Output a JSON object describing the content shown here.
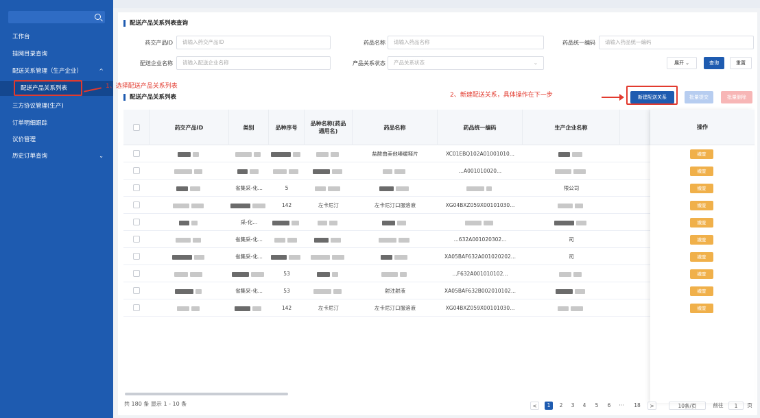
{
  "sidebar": {
    "items": [
      {
        "label": "工作台"
      },
      {
        "label": "挂网目录查询"
      },
      {
        "label": "配送关系管理（生产企业）",
        "chevron": "^"
      },
      {
        "label": "配送产品关系列表"
      },
      {
        "label": "三方协议管理(生产)"
      },
      {
        "label": "订单明细跟踪"
      },
      {
        "label": "议价管理"
      },
      {
        "label": "历史订单查询",
        "chevron": "⌄"
      }
    ]
  },
  "query": {
    "title": "配送产品关系列表查询",
    "fields": [
      {
        "label": "药交产品ID",
        "placeholder": "请输入药交产品ID"
      },
      {
        "label": "药品名称",
        "placeholder": "请输入药品名称"
      },
      {
        "label": "药品统一编码",
        "placeholder": "请输入药品统一编码"
      },
      {
        "label": "配送企业名称",
        "placeholder": "请输入配送企业名称"
      },
      {
        "label": "产品关系状态",
        "placeholder": "产品关系状态"
      }
    ],
    "expand_label": "展开 ⌄",
    "search_label": "查询",
    "reset_label": "重置"
  },
  "list": {
    "title": "配送产品关系列表",
    "new_label": "新建配送关系",
    "batch_submit_label": "批量提交",
    "batch_delete_label": "批量删除"
  },
  "annotations": {
    "step1": "1、选择配送产品关系列表",
    "step2": "2、新建配送关系，具体操作在下一步"
  },
  "table": {
    "headers": [
      "药交产品ID",
      "类别",
      "品种序号",
      "品种名称(药品通用名)",
      "药品名称",
      "药品统一编码",
      "生产企业名称",
      "",
      "操作"
    ],
    "row_action": "撤废",
    "rows": [
      {
        "cat": "",
        "seq": "",
        "name": "",
        "drug": "盐酸曲美他嗪缓释片",
        "code": "XC01EBQ102A01001010...",
        "mfr": ""
      },
      {
        "cat": "",
        "seq": "",
        "name": "",
        "drug": "",
        "code": "...A001010020...",
        "mfr": ""
      },
      {
        "cat": "省集采-化...",
        "seq": "5",
        "name": "",
        "drug": "",
        "code": "",
        "mfr": "限公司"
      },
      {
        "cat": "",
        "seq": "142",
        "name": "左卡尼汀",
        "drug": "左卡尼汀口服溶液",
        "code": "XG04BXZ059X00101030...",
        "mfr": ""
      },
      {
        "cat": "采-化...",
        "seq": "",
        "name": "",
        "drug": "",
        "code": "",
        "mfr": ""
      },
      {
        "cat": "省集采-化...",
        "seq": "",
        "name": "",
        "drug": "",
        "code": "...632A001020302...",
        "mfr": "司"
      },
      {
        "cat": "省集采-化...",
        "seq": "",
        "name": "",
        "drug": "",
        "code": "XA05BAF632A001020202...",
        "mfr": "司"
      },
      {
        "cat": "",
        "seq": "53",
        "name": "",
        "drug": "",
        "code": "...F632A001010102...",
        "mfr": ""
      },
      {
        "cat": "省集采-化...",
        "seq": "53",
        "name": "",
        "drug": "射注射液",
        "code": "XA05BAF632B002010102...",
        "mfr": ""
      },
      {
        "cat": "",
        "seq": "142",
        "name": "左卡尼汀",
        "drug": "左卡尼汀口服溶液",
        "code": "XG04BXZ059X00101030...",
        "mfr": ""
      }
    ]
  },
  "pagination": {
    "summary": "共 180 条  显示 1 - 10 条",
    "prev": "<",
    "pages": [
      "1",
      "2",
      "3",
      "4",
      "5",
      "6",
      "···",
      "18"
    ],
    "next": ">",
    "page_size": "10条/页",
    "goto_label": "前往",
    "goto_value": "1",
    "page_unit": "页"
  }
}
